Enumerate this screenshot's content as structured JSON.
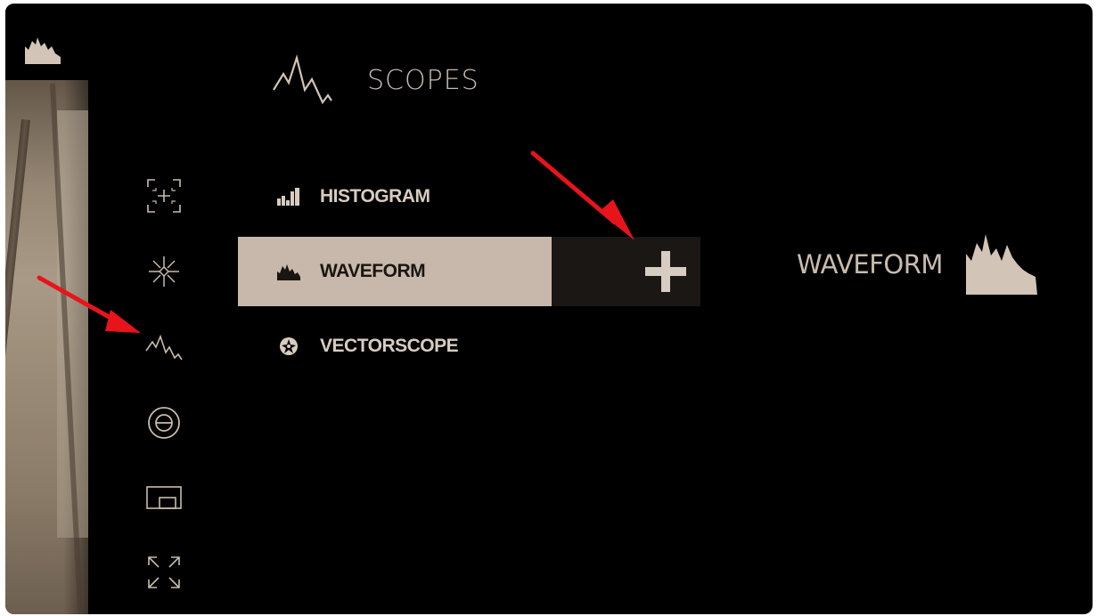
{
  "header": {
    "title": "SCOPES",
    "icon": "waveform-line-icon"
  },
  "sidebar": {
    "top_icon": "waveform-icon",
    "items": [
      {
        "name": "focus-assist",
        "icon": "focus-crosshair-icon"
      },
      {
        "name": "exposure",
        "icon": "aperture-icon"
      },
      {
        "name": "scopes",
        "icon": "waveform-line-icon"
      },
      {
        "name": "false-color",
        "icon": "circle-minus-icon"
      },
      {
        "name": "display",
        "icon": "monitor-icon"
      },
      {
        "name": "fullscreen",
        "icon": "expand-icon"
      }
    ]
  },
  "menu": {
    "items": [
      {
        "label": "HISTOGRAM",
        "icon": "histogram-icon",
        "selected": false
      },
      {
        "label": "WAVEFORM",
        "icon": "waveform-icon",
        "selected": true
      },
      {
        "label": "VECTORSCOPE",
        "icon": "vectorscope-icon",
        "selected": false
      }
    ],
    "add_button_icon": "plus-icon"
  },
  "preview": {
    "label": "WAVEFORM",
    "icon": "waveform-icon"
  },
  "colors": {
    "accent": "#c7b8ab",
    "background": "#000000",
    "annotation_arrow": "#e8141b"
  }
}
